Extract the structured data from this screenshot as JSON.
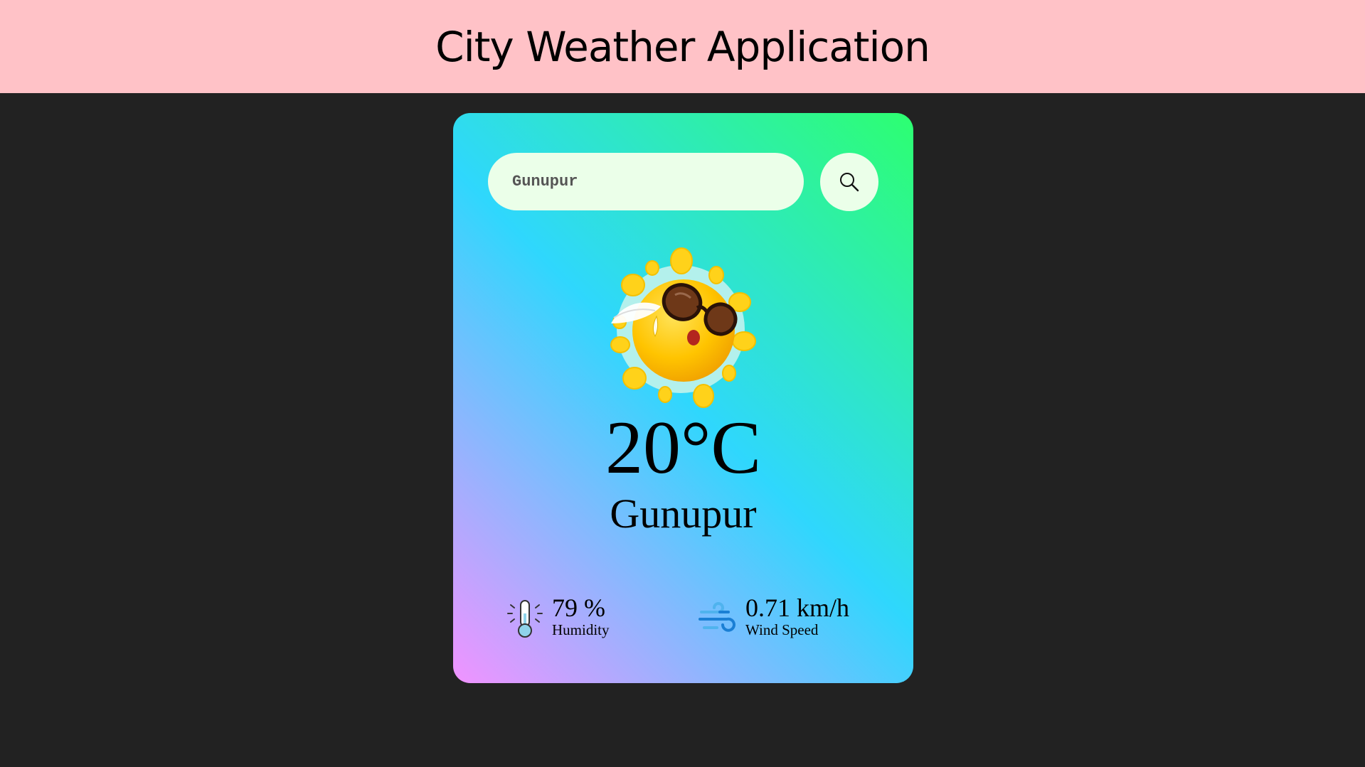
{
  "header": {
    "title": "City Weather Application"
  },
  "search": {
    "value": "Gunupur",
    "button_icon": "search-icon"
  },
  "weather": {
    "icon": "sun-with-sunglasses-icon",
    "temperature": "20°C",
    "city": "Gunupur",
    "humidity": {
      "icon": "thermometer-icon",
      "value": "79 %",
      "label": "Humidity"
    },
    "wind": {
      "icon": "wind-icon",
      "value": "0.71 km/h",
      "label": "Wind Speed"
    }
  },
  "colors": {
    "header_background": "#ffc2c7",
    "page_background": "#222222",
    "card_gradient": [
      "#f193ff",
      "#2fd7fd",
      "#2dff70"
    ],
    "input_background": "#ebffe9"
  }
}
